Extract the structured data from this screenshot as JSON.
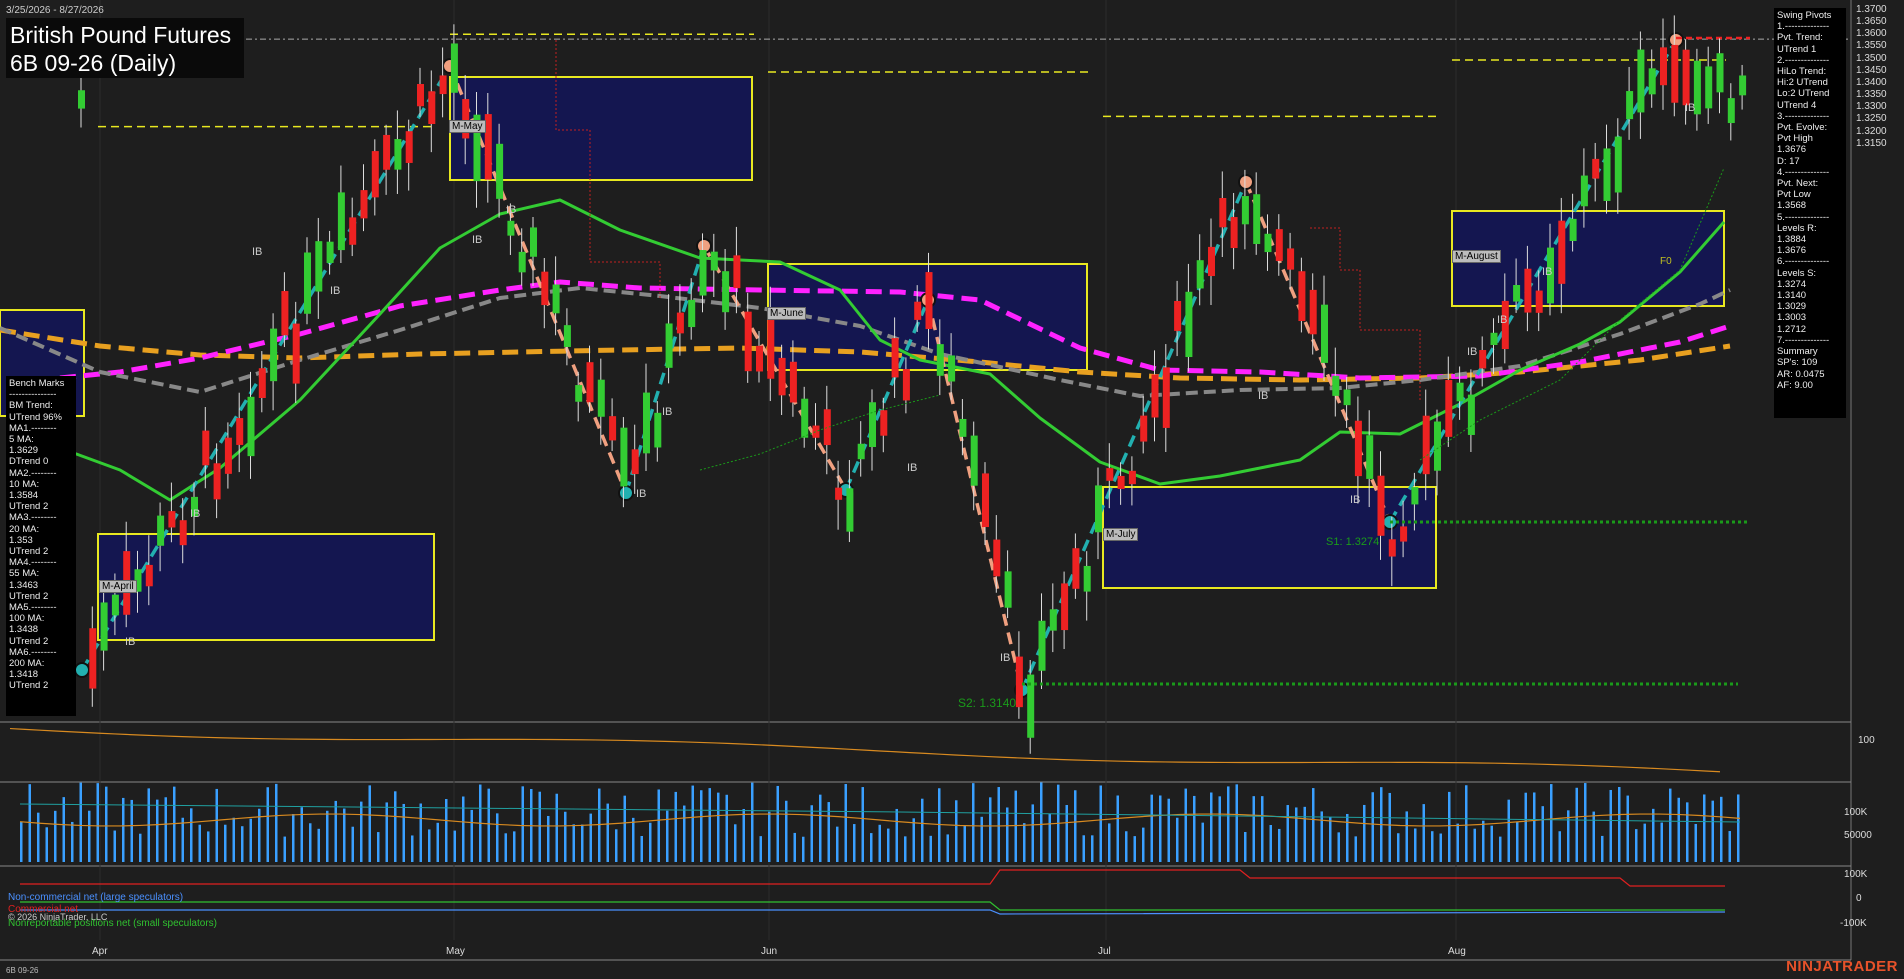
{
  "header": {
    "date_range": "3/25/2026 - 8/27/2026",
    "title_line1": "British Pound Futures",
    "title_line2": "6B 09-26 (Daily)"
  },
  "swing_panel": {
    "lines": [
      "Swing Pivots",
      "1.--------------",
      "Pvt. Trend:",
      "UTrend 1",
      "2.--------------",
      "HiLo Trend:",
      "Hi:2 UTrend",
      "Lo:2 UTrend",
      "UTrend 4",
      "3.--------------",
      "Pvt. Evolve:",
      "Pvt High",
      "1.3676",
      "D: 17",
      "4.--------------",
      "Pvt. Next:",
      "Pvt Low",
      "1.3568",
      "5.--------------",
      "Levels R:",
      "1.3884",
      "1.3676",
      "6.--------------",
      "Levels S:",
      "1.3274",
      "1.3140",
      "1.3029",
      "1.3003",
      "1.2712",
      "7.--------------",
      "Summary",
      "SP's: 109",
      "AR: 0.0475",
      "AF: 9.00"
    ]
  },
  "bench_panel": {
    "lines": [
      "Bench Marks",
      "---------------",
      "BM Trend:",
      "UTrend 96%",
      "MA1.--------",
      "5 MA:",
      "1.3629",
      "DTrend 0",
      "MA2.--------",
      "10 MA:",
      "1.3584",
      "UTrend 2",
      "MA3.--------",
      "20 MA:",
      "1.353",
      "UTrend 2",
      "MA4.--------",
      "55 MA:",
      "1.3463",
      "UTrend 2",
      "MA5.--------",
      "100 MA:",
      "1.3438",
      "UTrend 2",
      "MA6.--------",
      "200 MA:",
      "1.3418",
      "UTrend 2"
    ]
  },
  "price_axis": [
    "1.3700",
    "1.3650",
    "1.3600",
    "1.3550",
    "1.3500",
    "1.3450",
    "1.3400",
    "1.3350",
    "1.3300",
    "1.3250",
    "1.3200",
    "1.3150"
  ],
  "oscillator_axis": [
    "100"
  ],
  "volume_axis": [
    "100K",
    "50000"
  ],
  "cot_axis": [
    "100K",
    "0",
    "-100K"
  ],
  "x_axis": [
    "Apr",
    "May",
    "Jun",
    "Jul",
    "Aug"
  ],
  "month_boxes": [
    "M-April",
    "M-May",
    "M-June",
    "M-July",
    "M-August"
  ],
  "support_labels": {
    "s1": "S1: 1.3274",
    "s2": "S2: 1.3140",
    "f0": "F0"
  },
  "ib_label": "IB",
  "cot_legend": {
    "large": "Non-commercial net (large speculators)",
    "commercial": "Commercial net",
    "copyright": "© 2026 NinjaTrader, LLC",
    "small": "Nonreportable positions net (small speculators)"
  },
  "footer": {
    "symbol": "6B 09-26",
    "brand": "NINJATRADER"
  },
  "colors": {
    "up": "#33cc33",
    "down": "#ee2222",
    "ma_magenta": "#ff22ff",
    "ma_orange": "#e8a020",
    "ma_gray": "#888888",
    "ma_green": "#33cc33",
    "swing_up": "#22b0b0",
    "swing_down": "#f0a080",
    "box_fill": "#141650",
    "box_border": "#e8e820",
    "volume": "#3aa0ff"
  }
}
